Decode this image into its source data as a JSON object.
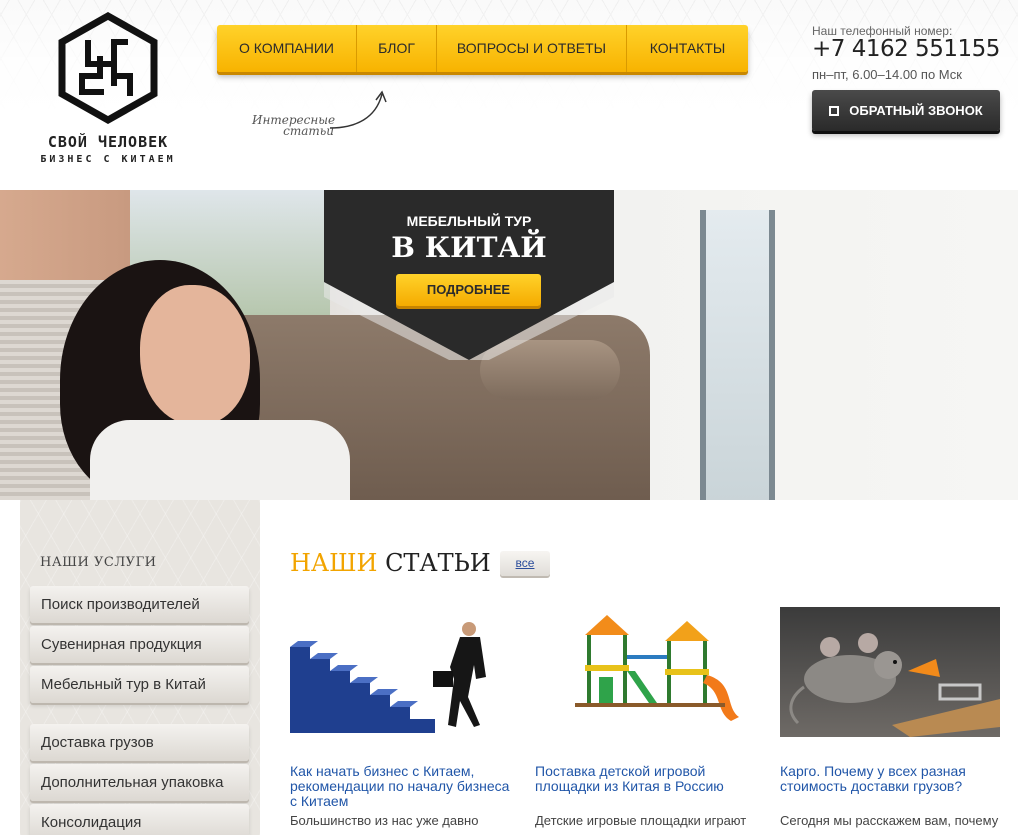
{
  "logo": {
    "name": "СВОЙ ЧЕЛОВЕК",
    "tagline": "БИЗНЕС С КИТАЕМ"
  },
  "nav": {
    "items": [
      {
        "label": "О КОМПАНИИ"
      },
      {
        "label": "БЛОГ"
      },
      {
        "label": "ВОПРОСЫ И ОТВЕТЫ"
      },
      {
        "label": "КОНТАКТЫ"
      }
    ],
    "note_line1": "Интересные",
    "note_line2": "статьи"
  },
  "contact": {
    "label": "Наш телефонный номер:",
    "phone": "+7 4162 551155",
    "hours": "пн–пт, 6.00–14.00 по Мск",
    "callback_label": "ОБРАТНЫЙ ЗВОНОК"
  },
  "hero": {
    "title": "МЕБЕЛЬНЫЙ ТУР",
    "subtitle": "В КИТАЙ",
    "button_label": "ПОДРОБНЕЕ"
  },
  "sidebar": {
    "title": "НАШИ УСЛУГИ",
    "items": [
      {
        "label": "Поиск производителей"
      },
      {
        "label": "Сувенирная продукция"
      },
      {
        "label": "Мебельный тур в Китай"
      },
      {
        "label": "Доставка грузов"
      },
      {
        "label": "Дополнительная упаковка"
      },
      {
        "label": "Консолидация"
      }
    ]
  },
  "articles": {
    "heading_accent": "НАШИ",
    "heading_rest": "СТАТЬИ",
    "all_label": "все",
    "cards": [
      {
        "title": "Как начать бизнес с Китаем, рекомендации по началу бизнеса с Китаем",
        "text": "Большинство из нас уже давно"
      },
      {
        "title": "Поставка детской игровой площадки из Китая в Россию",
        "text": "Детские игровые площадки играют"
      },
      {
        "title": "Карго. Почему у всех разная стоимость доставки грузов?",
        "text": "Сегодня мы расскажем вам, почему"
      }
    ]
  },
  "colors": {
    "accent": "#f2a400",
    "link": "#2156a8",
    "dark": "#2b2b2b"
  }
}
